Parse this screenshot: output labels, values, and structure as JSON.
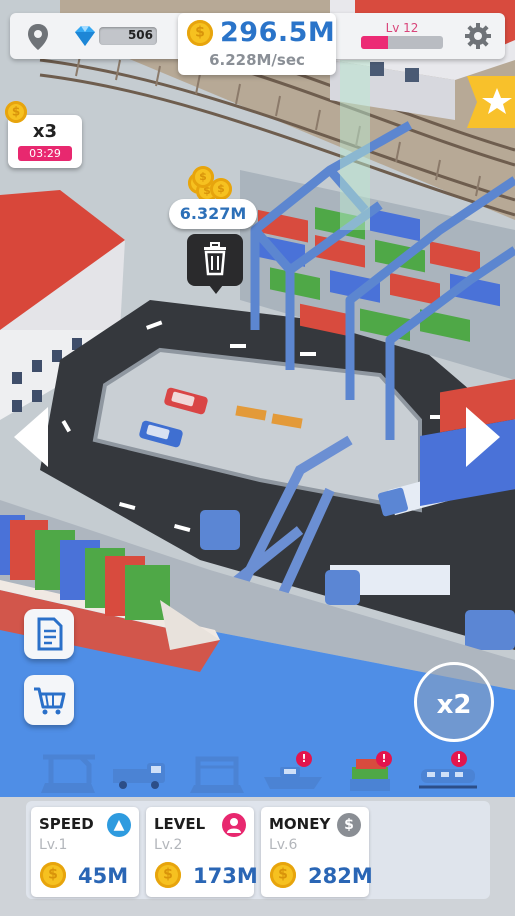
{
  "hud": {
    "gems": "506",
    "coins_total": "296.5M",
    "income_rate": "6.228M/sec",
    "level_label": "Lv 12",
    "level_progress": 0.33
  },
  "boost": {
    "multiplier": "x3",
    "timer": "03:29"
  },
  "floating_income": "6.327M",
  "speed_multiplier_button": "x2",
  "upgrades": [
    {
      "title": "SPEED",
      "level": "Lv.1",
      "cost": "45M",
      "badge_color": "#2e9bdf",
      "icon": "arrow-up-icon"
    },
    {
      "title": "LEVEL",
      "level": "Lv.2",
      "cost": "173M",
      "badge_color": "#e8286f",
      "icon": "person-icon"
    },
    {
      "title": "MONEY",
      "level": "Lv.6",
      "cost": "282M",
      "badge_color": "#8a8e94",
      "icon": "dollar-icon"
    }
  ],
  "tabs": [
    {
      "name": "crane",
      "alert": false
    },
    {
      "name": "truck",
      "alert": false
    },
    {
      "name": "gantry",
      "alert": false
    },
    {
      "name": "ship",
      "alert": true
    },
    {
      "name": "containers",
      "alert": true
    },
    {
      "name": "train",
      "alert": true
    }
  ],
  "colors": {
    "accent": "#2a74c9",
    "level_bar": "#ec2b75",
    "sea": "#4f8ee6"
  }
}
